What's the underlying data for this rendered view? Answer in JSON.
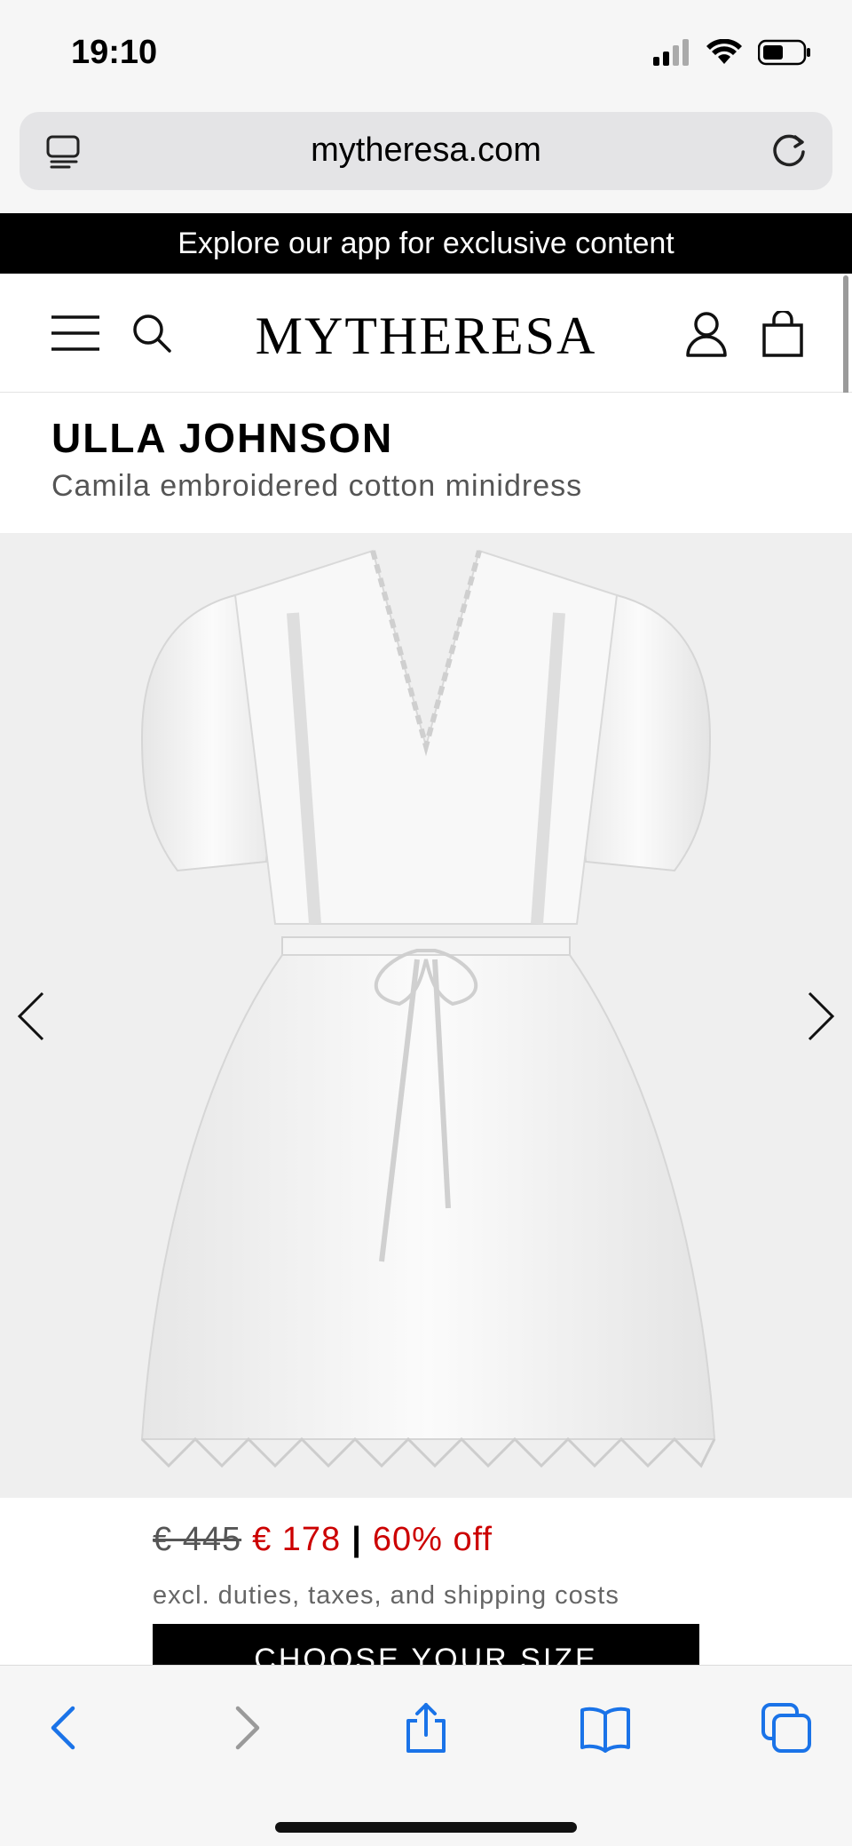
{
  "status": {
    "time": "19:10",
    "icons": [
      "signal-icon",
      "wifi-icon",
      "battery-icon"
    ]
  },
  "browser": {
    "url": "mytheresa.com",
    "icons": [
      "tab-overview-icon",
      "reload-icon"
    ]
  },
  "promo": {
    "text": "Explore our app for exclusive content"
  },
  "header": {
    "logo": "MYTHERESA",
    "icons": [
      "menu-icon",
      "search-icon",
      "account-icon",
      "bag-icon"
    ]
  },
  "product": {
    "brand": "ULLA JOHNSON",
    "name": "Camila embroidered cotton minidress",
    "price_old": "€ 445",
    "price_new": "€ 178",
    "price_separator": "|",
    "discount": "60% off",
    "note": "excl. duties, taxes, and shipping costs",
    "size_button": "CHOOSE YOUR SIZE"
  },
  "gallery": {
    "icons": [
      "chevron-left-icon",
      "chevron-right-icon"
    ]
  },
  "toolbar": {
    "icons": [
      "back-icon",
      "forward-icon",
      "share-icon",
      "bookmarks-icon",
      "tabs-icon"
    ]
  },
  "colors": {
    "accent": "#1a73e8",
    "sale": "#cc0000",
    "banner": "#000000"
  }
}
